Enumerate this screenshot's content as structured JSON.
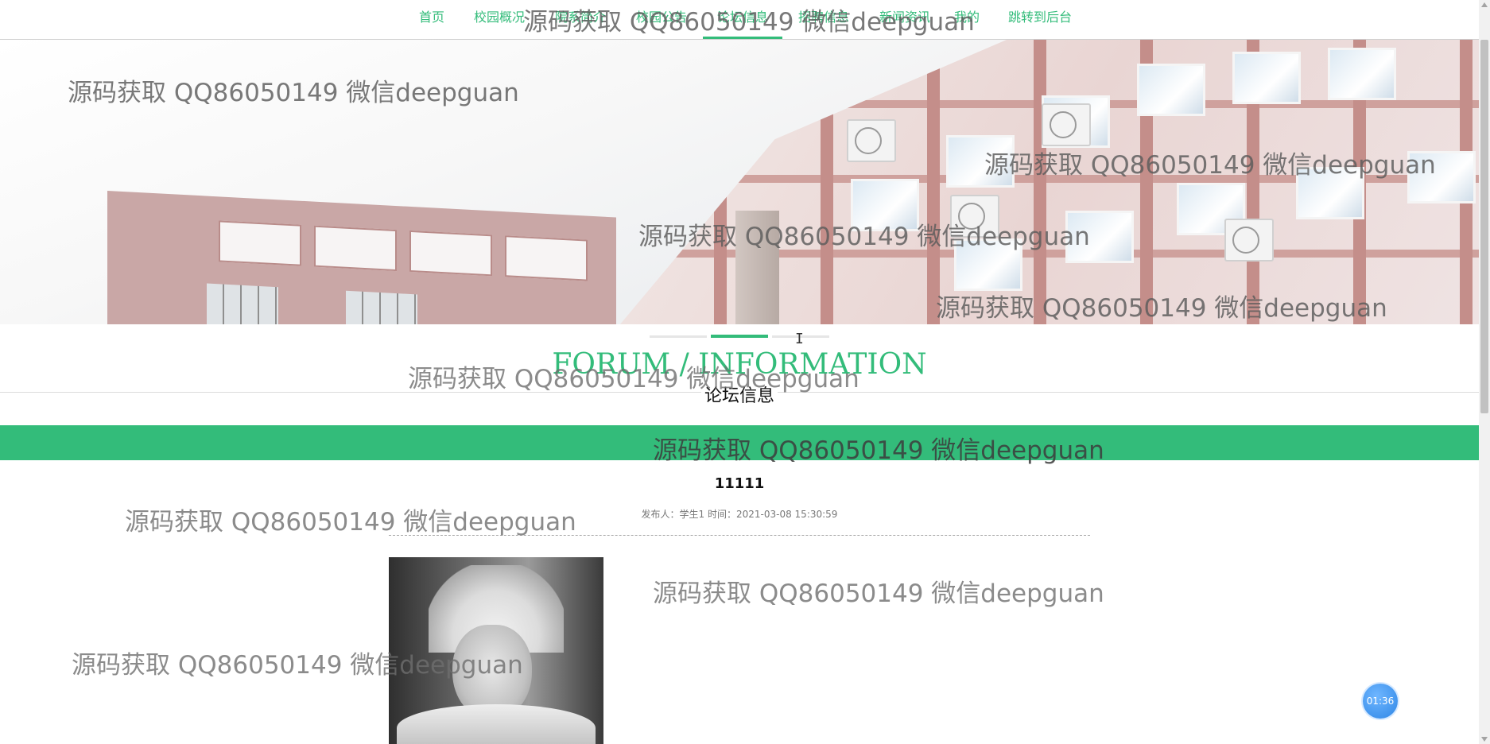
{
  "nav": {
    "items": [
      "首页",
      "校园概况",
      "院系简介",
      "校园公告",
      "论坛信息",
      "招聘信息",
      "新闻资讯",
      "我的",
      "跳转到后台"
    ],
    "active_index": 4,
    "accent": "#33bc7a"
  },
  "banner": {
    "slides": 3,
    "active_slide": 2
  },
  "section": {
    "title_en": "FORUM / INFORMATION",
    "title_cn": "论坛信息"
  },
  "post": {
    "title": "11111",
    "meta": "发布人：学生1 时间：2021-03-08 15:30:59",
    "image_icon": "portrait-photo"
  },
  "timer": "01:36",
  "watermark": "源码获取 QQ86050149 微信deepguan",
  "colors": {
    "accent": "#33bc7a",
    "timer": "#2f87e6"
  }
}
